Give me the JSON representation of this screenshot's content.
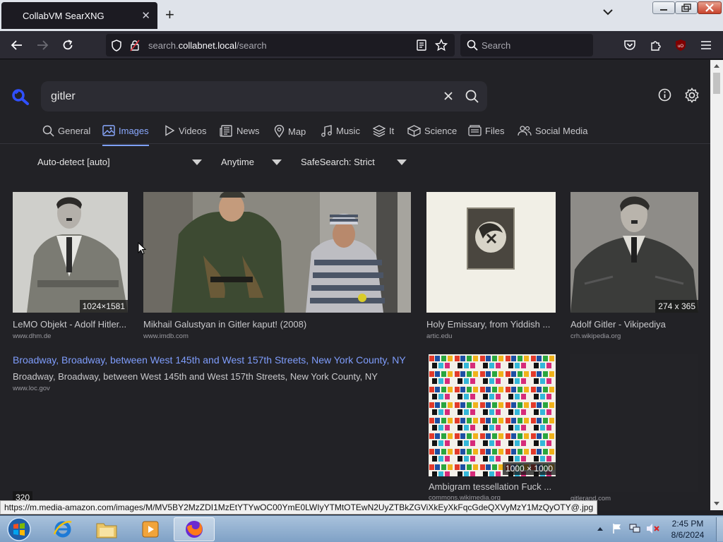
{
  "browser": {
    "tab_title": "CollabVM SearXNG",
    "url_prefix": "search.",
    "url_host": "collabnet.local",
    "url_path": "/search",
    "search_placeholder": "Search"
  },
  "search": {
    "query": "gitler"
  },
  "categories": [
    {
      "label": "General",
      "icon": "search-icon"
    },
    {
      "label": "Images",
      "icon": "image-icon",
      "active": true
    },
    {
      "label": "Videos",
      "icon": "play-icon"
    },
    {
      "label": "News",
      "icon": "newspaper-icon"
    },
    {
      "label": "Map",
      "icon": "map-pin-icon"
    },
    {
      "label": "Music",
      "icon": "music-icon"
    },
    {
      "label": "It",
      "icon": "layers-icon"
    },
    {
      "label": "Science",
      "icon": "cube-icon"
    },
    {
      "label": "Files",
      "icon": "files-icon"
    },
    {
      "label": "Social Media",
      "icon": "people-icon"
    }
  ],
  "filters": {
    "language": "Auto-detect [auto]",
    "time": "Anytime",
    "safesearch": "SafeSearch: Strict"
  },
  "results": [
    {
      "title": "LeMO Objekt - Adolf Hitler...",
      "url": "www.dhm.de",
      "resolution": "1024×1581"
    },
    {
      "title": "Mikhail Galustyan in Gitler kaput! (2008)",
      "url": "www.imdb.com",
      "resolution": ""
    },
    {
      "title": "Holy Emissary, from Yiddish ...",
      "url": "artic.edu",
      "resolution": ""
    },
    {
      "title": "Adolf Gitler - Vikipediya",
      "url": "crh.wikipedia.org",
      "resolution": "274 x 365"
    },
    {
      "title": "Broadway, Broadway, between West 145th and West 157th Streets, New York County, NY",
      "subtitle": "Broadway, Broadway, between West 145th and West 157th Streets, New York County, NY",
      "url": "www.loc.gov"
    },
    {
      "title": "Ambigram tessellation Fuck ...",
      "url": "commons.wikimedia.org",
      "resolution": "1000 × 1000"
    },
    {
      "title": "",
      "url": "gitlerand.com",
      "resolution": ""
    },
    {
      "title": "",
      "url": "",
      "resolution": "320"
    }
  ],
  "status_link": "https://m.media-amazon.com/images/M/MV5BY2MzZDI1MzEtYTYwOC00YmE0LWIyYTMtOTEwN2UyZTBkZGViXkEyXkFqcGdeQXVyMzY1MzQyOTY@.jpg",
  "taskbar": {
    "time": "2:45 PM",
    "date": "8/6/2024"
  },
  "colors": {
    "page_bg": "#222226",
    "accent": "#7f9dfc",
    "tab_strip": "#dfe3ea"
  }
}
